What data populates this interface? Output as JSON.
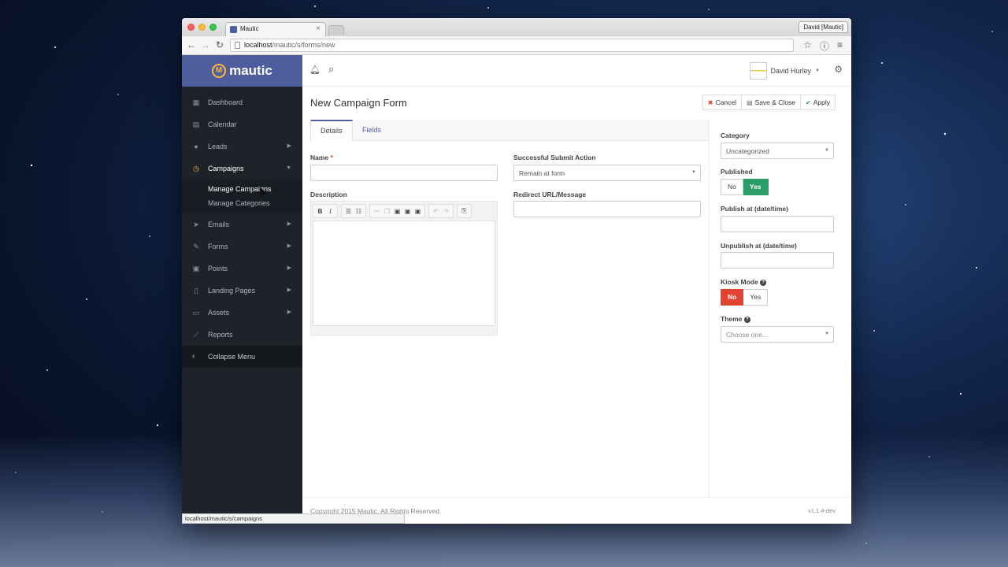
{
  "browser": {
    "tab_title": "Mautic",
    "tab_close": "×",
    "profile": "David [Mautic]",
    "url_host": "localhost",
    "url_path": "/mautic/s/forms/new",
    "status_url": "localhost/mautic/s/campaigns"
  },
  "brand": {
    "name": "mautic"
  },
  "sidebar": {
    "items": [
      {
        "label": "Dashboard",
        "icon": "dashboard-icon"
      },
      {
        "label": "Calendar",
        "icon": "calendar-icon"
      },
      {
        "label": "Leads",
        "icon": "user-icon"
      },
      {
        "label": "Campaigns",
        "icon": "clock-icon"
      },
      {
        "label": "Emails",
        "icon": "paper-plane-icon"
      },
      {
        "label": "Forms",
        "icon": "pencil-square-icon"
      },
      {
        "label": "Points",
        "icon": "calculator-icon"
      },
      {
        "label": "Landing Pages",
        "icon": "file-icon"
      },
      {
        "label": "Assets",
        "icon": "folder-icon"
      },
      {
        "label": "Reports",
        "icon": "line-chart-icon"
      }
    ],
    "campaigns_sub": [
      "Manage Campaigns",
      "Manage Categories"
    ],
    "collapse_label": "Collapse Menu"
  },
  "topbar": {
    "user_name": "David Hurley"
  },
  "page": {
    "title": "New Campaign Form",
    "cancel_label": "Cancel",
    "save_close_label": "Save & Close",
    "apply_label": "Apply"
  },
  "tabs": {
    "details": "Details",
    "fields": "Fields"
  },
  "form": {
    "name_label": "Name",
    "required_mark": "*",
    "name_value": "",
    "description_label": "Description",
    "submit_action_label": "Successful Submit Action",
    "submit_action_value": "Remain at form",
    "redirect_label": "Redirect URL/Message",
    "redirect_value": ""
  },
  "settings": {
    "category_label": "Category",
    "category_value": "Uncategorized",
    "published_label": "Published",
    "published_no": "No",
    "published_yes": "Yes",
    "published_value": "Yes",
    "publish_at_label": "Publish at (date/time)",
    "unpublish_at_label": "Unpublish at (date/time)",
    "kiosk_label": "Kiosk Mode",
    "kiosk_no": "No",
    "kiosk_yes": "Yes",
    "kiosk_value": "No",
    "theme_label": "Theme",
    "theme_placeholder": "Choose one..."
  },
  "footer": {
    "copyright": "Copyright 2015 Mautic. All Rights Reserved.",
    "version": "v1.1.4-dev"
  },
  "colors": {
    "brand": "#4e5d9d",
    "sidebar_bg": "#1e2329",
    "accent_yellow": "#fdb933",
    "yes_green": "#2a9d69",
    "no_red": "#e0432f"
  }
}
